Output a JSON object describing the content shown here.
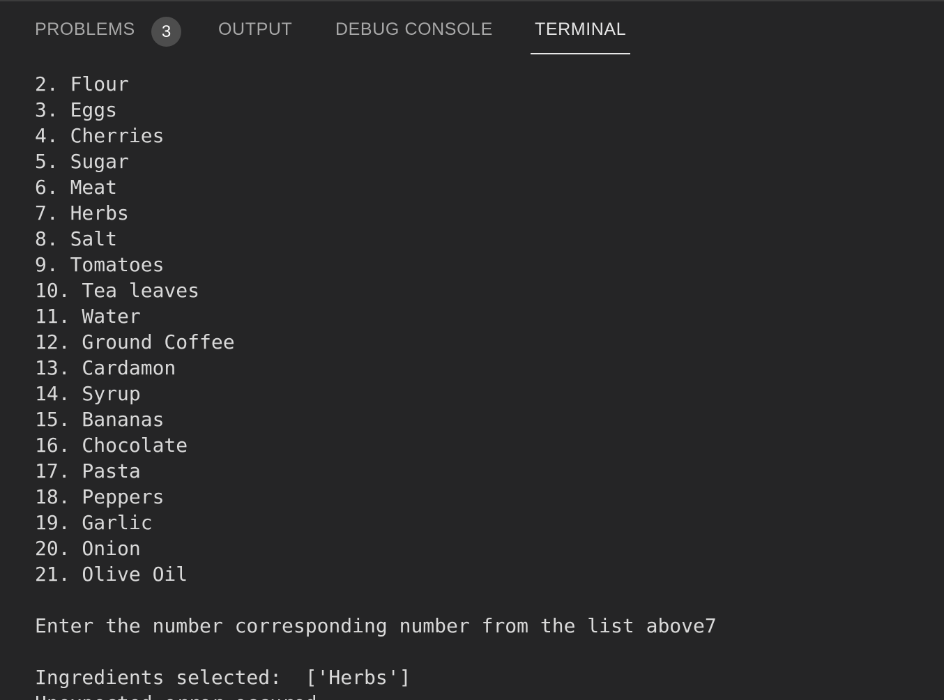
{
  "tabs": {
    "problems": "PROBLEMS",
    "problems_count": "3",
    "output": "OUTPUT",
    "debug_console": "DEBUG CONSOLE",
    "terminal": "TERMINAL"
  },
  "terminal": {
    "lines": [
      "2. Flour",
      "3. Eggs",
      "4. Cherries",
      "5. Sugar",
      "6. Meat",
      "7. Herbs",
      "8. Salt",
      "9. Tomatoes",
      "10. Tea leaves",
      "11. Water",
      "12. Ground Coffee",
      "13. Cardamon",
      "14. Syrup",
      "15. Bananas",
      "16. Chocolate",
      "17. Pasta",
      "18. Peppers",
      "19. Garlic",
      "20. Onion",
      "21. Olive Oil",
      "",
      "Enter the number corresponding number from the list above7",
      "",
      "Ingredients selected:  ['Herbs']",
      "Unexpected error occured"
    ]
  }
}
